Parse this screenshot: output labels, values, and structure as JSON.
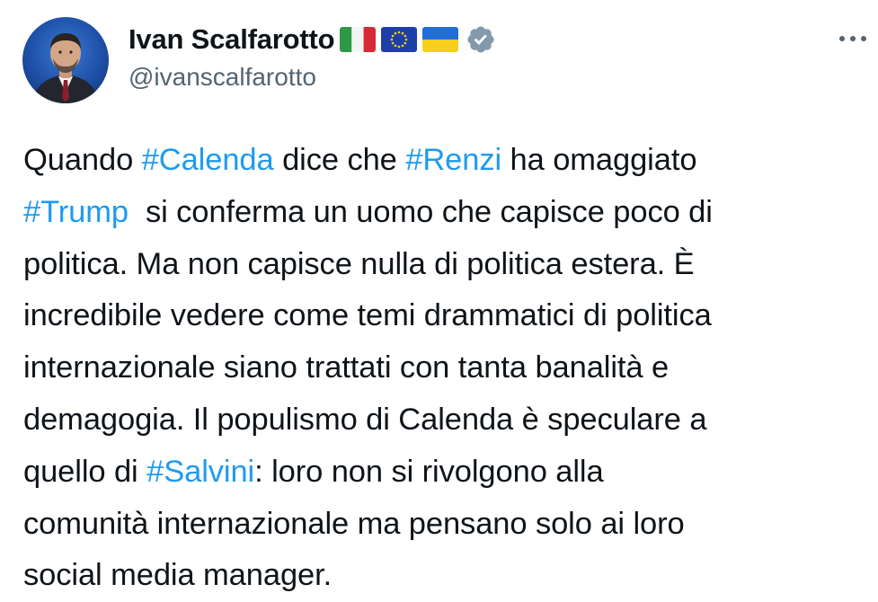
{
  "author": {
    "display_name": "Ivan Scalfarotto",
    "handle": "@ivanscalfarotto",
    "flags": [
      "italy-flag-icon",
      "eu-flag-icon",
      "ukraine-flag-icon"
    ],
    "verified": true,
    "avatar": "avatar"
  },
  "header": {
    "more_icon": "more-horizontal-icon"
  },
  "tweet": {
    "lines": [
      [
        {
          "text": "Quando ",
          "hashtag": false
        },
        {
          "text": "#Calenda",
          "hashtag": true
        },
        {
          "text": " dice che ",
          "hashtag": false
        },
        {
          "text": "#Renzi",
          "hashtag": true
        },
        {
          "text": " ha omaggiato",
          "hashtag": false
        }
      ],
      [
        {
          "text": "#Trump",
          "hashtag": true
        },
        {
          "text": "  si conferma un uomo che capisce poco di",
          "hashtag": false
        }
      ],
      [
        {
          "text": "politica. Ma non capisce nulla di politica estera. È",
          "hashtag": false
        }
      ],
      [
        {
          "text": "incredibile vedere come temi drammatici di politica",
          "hashtag": false
        }
      ],
      [
        {
          "text": "internazionale siano trattati con tanta banalità e",
          "hashtag": false
        }
      ],
      [
        {
          "text": "demagogia. Il populismo di Calenda è speculare a",
          "hashtag": false
        }
      ],
      [
        {
          "text": "quello di ",
          "hashtag": false
        },
        {
          "text": "#Salvini",
          "hashtag": true
        },
        {
          "text": ": loro non si rivolgono alla",
          "hashtag": false
        }
      ],
      [
        {
          "text": "comunità internazionale ma pensano solo ai loro",
          "hashtag": false
        }
      ],
      [
        {
          "text": "social media manager.",
          "hashtag": false
        }
      ]
    ]
  },
  "colors": {
    "text": "#0f1419",
    "secondary": "#536471",
    "hashtag": "#1d9bf0",
    "verified_badge": "#829aab"
  }
}
